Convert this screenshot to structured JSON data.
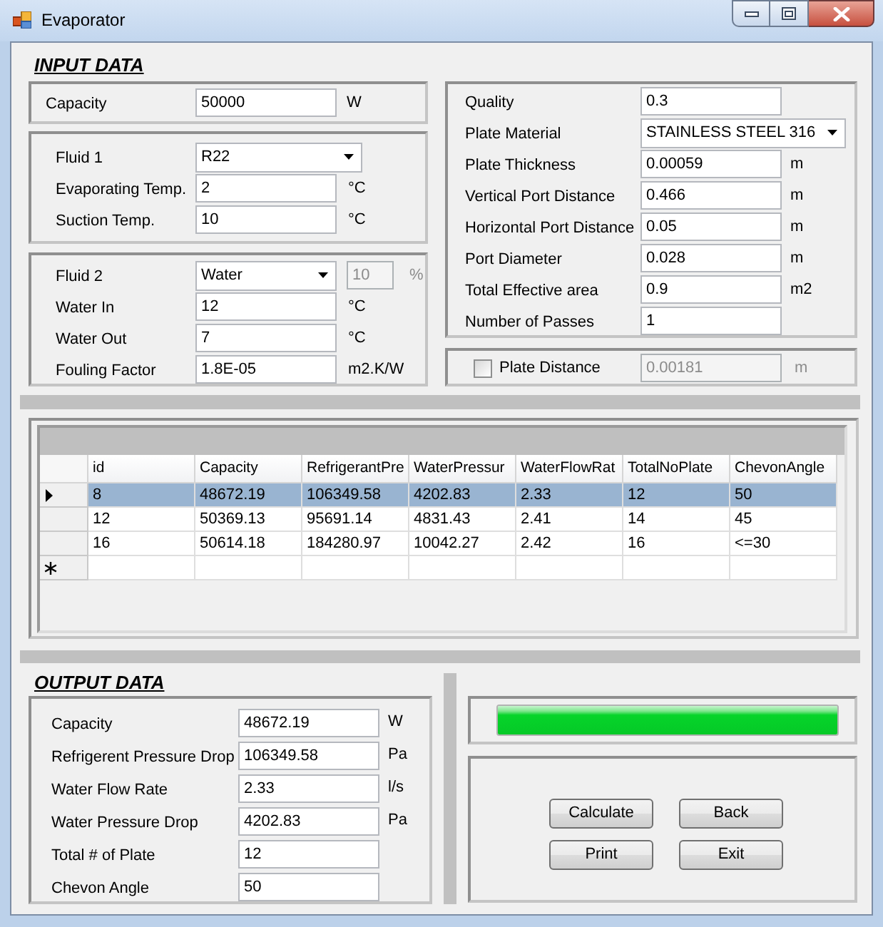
{
  "window": {
    "title": "Evaporator"
  },
  "input_data": {
    "heading": "INPUT DATA",
    "left_groups": [
      {
        "fields": [
          {
            "kind": "text",
            "label": "Capacity",
            "value": "50000",
            "unit": "W"
          }
        ]
      },
      {
        "fields": [
          {
            "kind": "dropdown",
            "label": "Fluid 1",
            "value": "R22"
          },
          {
            "kind": "text",
            "label": "Evaporating Temp.",
            "value": "2",
            "unit": "°C"
          },
          {
            "kind": "text",
            "label": "Suction Temp.",
            "value": "10",
            "unit": "°C"
          }
        ]
      },
      {
        "fields": [
          {
            "kind": "dropdown",
            "label": "Fluid 2",
            "value": "Water",
            "secondary": {
              "value": "10",
              "unit": "%",
              "disabled": true
            }
          },
          {
            "kind": "text",
            "label": "Water In",
            "value": "12",
            "unit": "°C"
          },
          {
            "kind": "text",
            "label": "Water Out",
            "value": "7",
            "unit": "°C"
          },
          {
            "kind": "text",
            "label": "Fouling Factor",
            "value": "1.8E-05",
            "unit": "m2.K/W"
          }
        ]
      }
    ],
    "right_groups": [
      {
        "fields": [
          {
            "kind": "text",
            "label": "Quality",
            "value": "0.3"
          },
          {
            "kind": "dropdown",
            "label": "Plate Material",
            "value": "STAINLESS STEEL 316"
          },
          {
            "kind": "text",
            "label": "Plate Thickness",
            "value": "0.00059",
            "unit": "m"
          },
          {
            "kind": "text",
            "label": "Vertical Port Distance",
            "value": "0.466",
            "unit": "m"
          },
          {
            "kind": "text",
            "label": "Horizontal Port Distance",
            "value": "0.05",
            "unit": "m"
          },
          {
            "kind": "text",
            "label": "Port Diameter",
            "value": "0.028",
            "unit": "m"
          },
          {
            "kind": "text",
            "label": "Total Effective area",
            "value": "0.9",
            "unit": "m2"
          },
          {
            "kind": "text",
            "label": "Number of Passes",
            "value": "1"
          }
        ]
      },
      {
        "fields": [
          {
            "kind": "checkbox",
            "label": "Plate Distance",
            "checked": false,
            "value": "0.00181",
            "unit": "m",
            "disabled": true
          }
        ]
      }
    ]
  },
  "results_table": {
    "columns": [
      "id",
      "Capacity",
      "RefrigerantPre",
      "WaterPressur",
      "WaterFlowRat",
      "TotalNoPlate",
      "ChevonAngle"
    ],
    "rows": [
      {
        "selected": true,
        "current": true,
        "cells": [
          "8",
          "48672.19",
          "106349.58",
          "4202.83",
          "2.33",
          "12",
          "50"
        ]
      },
      {
        "selected": false,
        "current": false,
        "cells": [
          "12",
          "50369.13",
          "95691.14",
          "4831.43",
          "2.41",
          "14",
          "45"
        ]
      },
      {
        "selected": false,
        "current": false,
        "cells": [
          "16",
          "50614.18",
          "184280.97",
          "10042.27",
          "2.42",
          "16",
          "<=30"
        ]
      }
    ],
    "new_row": true
  },
  "output_data": {
    "heading": "OUTPUT DATA",
    "fields": [
      {
        "label": "Capacity",
        "value": "48672.19",
        "unit": "W"
      },
      {
        "label": "Refrigerent Pressure Drop",
        "value": "106349.58",
        "unit": "Pa"
      },
      {
        "label": "Water Flow Rate",
        "value": "2.33",
        "unit": "l/s"
      },
      {
        "label": "Water Pressure Drop",
        "value": "4202.83",
        "unit": "Pa"
      },
      {
        "label": "Total # of Plate",
        "value": "12"
      },
      {
        "label": "Chevon Angle",
        "value": "50"
      }
    ]
  },
  "progress": {
    "level": 1
  },
  "buttons": [
    "Calculate",
    "Back",
    "Print",
    "Exit"
  ]
}
